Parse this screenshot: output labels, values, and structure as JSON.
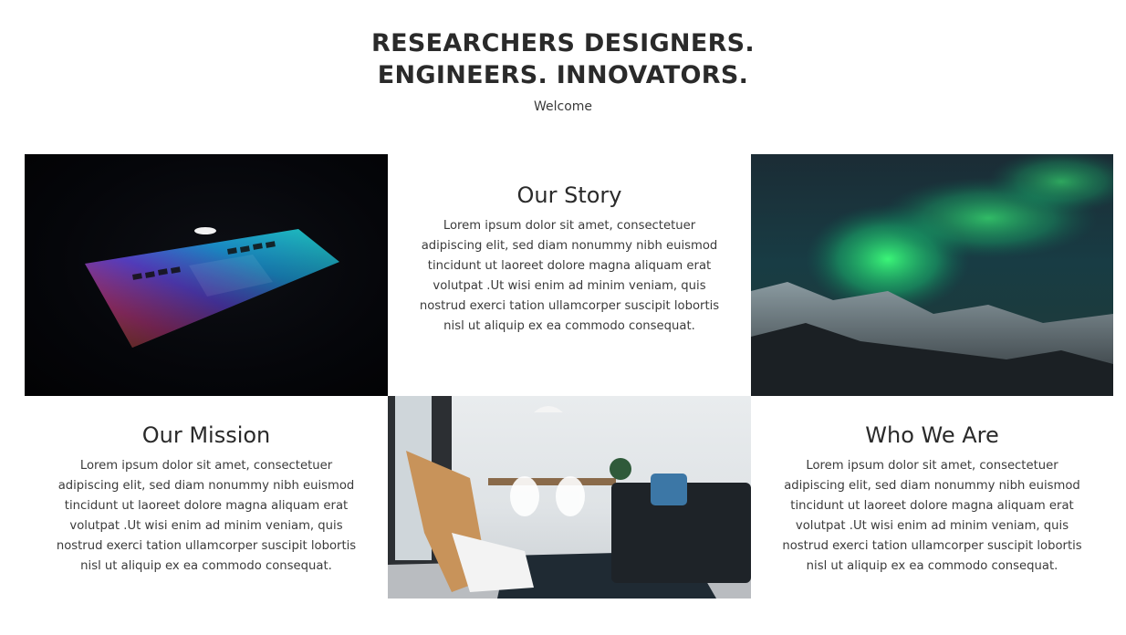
{
  "hero": {
    "title_line1": "RESEARCHERS DESIGNERS.",
    "title_line2": "ENGINEERS. INNOVATORS.",
    "subtitle": "Welcome"
  },
  "sections": {
    "story": {
      "title": "Our Story",
      "body": "Lorem ipsum dolor sit amet, consectetuer adipiscing elit, sed diam nonummy nibh euismod tincidunt ut laoreet dolore magna aliquam erat volutpat .Ut wisi enim ad minim veniam, quis nostrud exerci tation ullamcorper suscipit lobortis nisl ut aliquip ex ea commodo consequat."
    },
    "mission": {
      "title": "Our Mission",
      "body": "Lorem ipsum dolor sit amet, consectetuer adipiscing elit, sed diam nonummy nibh euismod tincidunt ut laoreet dolore magna aliquam erat volutpat .Ut wisi enim ad minim veniam, quis nostrud exerci tation ullamcorper suscipit lobortis nisl ut aliquip ex ea commodo consequat."
    },
    "who": {
      "title": "Who We Are",
      "body": "Lorem ipsum dolor sit amet, consectetuer adipiscing elit, sed diam nonummy nibh euismod tincidunt ut laoreet dolore magna aliquam erat volutpat .Ut wisi enim ad minim veniam, quis nostrud exerci tation ullamcorper suscipit lobortis nisl ut aliquip ex ea commodo consequat."
    }
  },
  "images": {
    "laptop": "laptop-photo",
    "aurora": "aurora-photo",
    "room": "living-room-photo"
  },
  "colors": {
    "text": "#2a2a2a",
    "background": "#ffffff"
  }
}
